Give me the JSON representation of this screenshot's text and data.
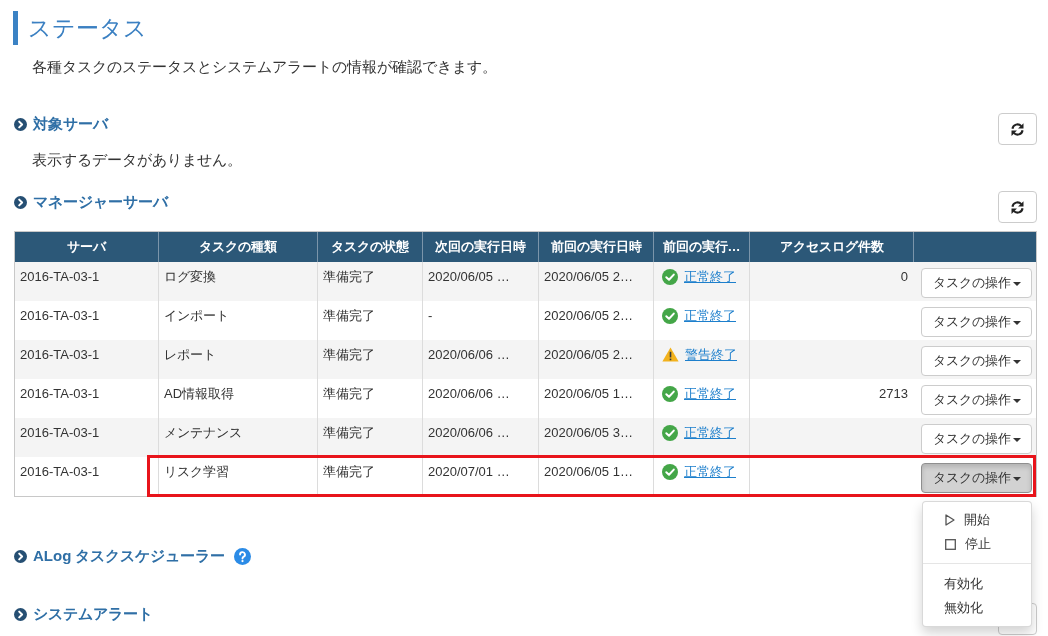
{
  "page": {
    "title": "ステータス",
    "description": "各種タスクのステータスとシステムアラートの情報が確認できます。"
  },
  "sections": [
    {
      "title": "対象サーバ",
      "help": false,
      "refresh_button": true,
      "empty_message": "表示するデータがありません。"
    },
    {
      "title": "マネージャーサーバ",
      "help": false,
      "refresh_button": true,
      "table": {
        "columns": [
          "サーバ",
          "タスクの種類",
          "タスクの状態",
          "次回の実行日時",
          "前回の実行日時",
          "前回の実行…",
          "アクセスログ件数"
        ],
        "rows": [
          {
            "server": "2016-TA-03-1",
            "task_type": "ログ変換",
            "task_state": "準備完了",
            "next_run": "2020/06/05 …",
            "last_run": "2020/06/05 2…",
            "last_result": {
              "kind": "success",
              "label": "正常終了"
            },
            "access_log_count": "0",
            "action": {
              "label": "タスクの操作",
              "pressed": false
            },
            "highlighted": false
          },
          {
            "server": "2016-TA-03-1",
            "task_type": "インポート",
            "task_state": "準備完了",
            "next_run": "-",
            "last_run": "2020/06/05 2…",
            "last_result": {
              "kind": "success",
              "label": "正常終了"
            },
            "action": {
              "label": "タスクの操作",
              "pressed": false
            },
            "highlighted": false
          },
          {
            "server": "2016-TA-03-1",
            "task_type": "レポート",
            "task_state": "準備完了",
            "next_run": "2020/06/06 …",
            "last_run": "2020/06/05 2…",
            "last_result": {
              "kind": "warning",
              "label": "警告終了"
            },
            "action": {
              "label": "タスクの操作",
              "pressed": false
            },
            "highlighted": false
          },
          {
            "server": "2016-TA-03-1",
            "task_type": "AD情報取得",
            "task_state": "準備完了",
            "next_run": "2020/06/06 …",
            "last_run": "2020/06/05 1…",
            "last_result": {
              "kind": "success",
              "label": "正常終了"
            },
            "access_log_count": "2713",
            "action": {
              "label": "タスクの操作",
              "pressed": false
            },
            "highlighted": false
          },
          {
            "server": "2016-TA-03-1",
            "task_type": "メンテナンス",
            "task_state": "準備完了",
            "next_run": "2020/06/06 …",
            "last_run": "2020/06/05 3…",
            "last_result": {
              "kind": "success",
              "label": "正常終了"
            },
            "action": {
              "label": "タスクの操作",
              "pressed": false
            },
            "highlighted": false
          },
          {
            "server": "2016-TA-03-1",
            "task_type": "リスク学習",
            "task_state": "準備完了",
            "next_run": "2020/07/01 …",
            "last_run": "2020/06/05 1…",
            "last_result": {
              "kind": "success",
              "label": "正常終了"
            },
            "action": {
              "label": "タスクの操作",
              "pressed": true
            },
            "highlighted": true,
            "menu": {
              "groups": [
                {
                  "items": [
                    {
                      "kind": "play",
                      "label": "開始"
                    },
                    {
                      "kind": "stop",
                      "label": "停止"
                    }
                  ]
                },
                {
                  "items": [
                    {
                      "kind": "plain",
                      "label": "有効化"
                    },
                    {
                      "kind": "plain",
                      "label": "無効化"
                    }
                  ]
                }
              ]
            }
          }
        ]
      }
    },
    {
      "title": "ALog タスクスケジューラー",
      "help": true,
      "refresh_button": false
    },
    {
      "title": "システムアラート",
      "help": false,
      "refresh_button": true
    }
  ]
}
